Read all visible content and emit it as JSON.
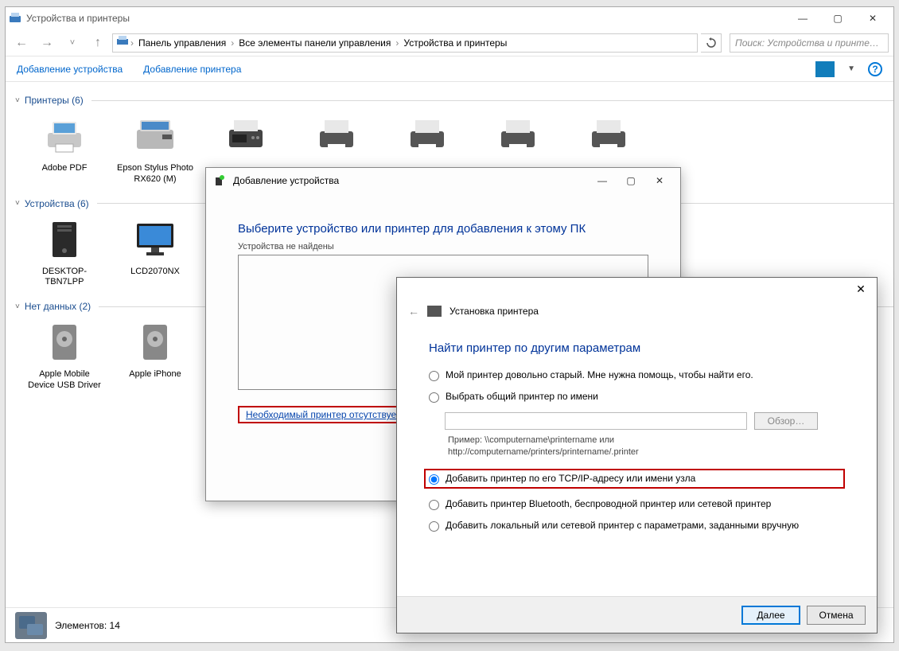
{
  "window": {
    "title": "Устройства и принтеры",
    "breadcrumb": {
      "root": "Панель управления",
      "mid": "Все элементы панели управления",
      "leaf": "Устройства и принтеры"
    },
    "search_placeholder": "Поиск: Устройства и принте…",
    "toolbar": {
      "add_device": "Добавление устройства",
      "add_printer": "Добавление принтера"
    },
    "groups": {
      "printers": {
        "title": "Принтеры (6)",
        "items": [
          {
            "label": "Adobe PDF"
          },
          {
            "label": "Epson Stylus Photo RX620 (M)"
          },
          {
            "label": ""
          },
          {
            "label": ""
          },
          {
            "label": ""
          },
          {
            "label": ""
          },
          {
            "label": ""
          }
        ]
      },
      "devices": {
        "title": "Устройства (6)",
        "items": [
          {
            "label": "DESKTOP-TBN7LPP"
          },
          {
            "label": "LCD2070NX"
          },
          {
            "label": ""
          }
        ]
      },
      "nodata": {
        "title": "Нет данных (2)",
        "items": [
          {
            "label": "Apple Mobile Device USB Driver"
          },
          {
            "label": "Apple iPhone"
          }
        ]
      }
    },
    "status": "Элементов: 14"
  },
  "wizard_add": {
    "title": "Добавление устройства",
    "heading": "Выберите устройство или принтер для добавления к этому ПК",
    "subtext": "Устройства не найдены",
    "missing_link": "Необходимый принтер отсутствует"
  },
  "wizard_install": {
    "header": "Установка принтера",
    "heading": "Найти принтер по другим параметрам",
    "opt1": "Мой принтер довольно старый. Мне нужна помощь, чтобы найти его.",
    "opt2": "Выбрать общий принтер по имени",
    "browse_label": "Обзор…",
    "example1": "Пример: \\\\computername\\printername или",
    "example2": "http://computername/printers/printername/.printer",
    "opt3": "Добавить принтер по его TCP/IP-адресу или имени узла",
    "opt4": "Добавить принтер Bluetooth, беспроводной принтер или сетевой принтер",
    "opt5": "Добавить локальный или сетевой принтер с параметрами, заданными вручную",
    "next": "Далее",
    "cancel": "Отмена"
  }
}
